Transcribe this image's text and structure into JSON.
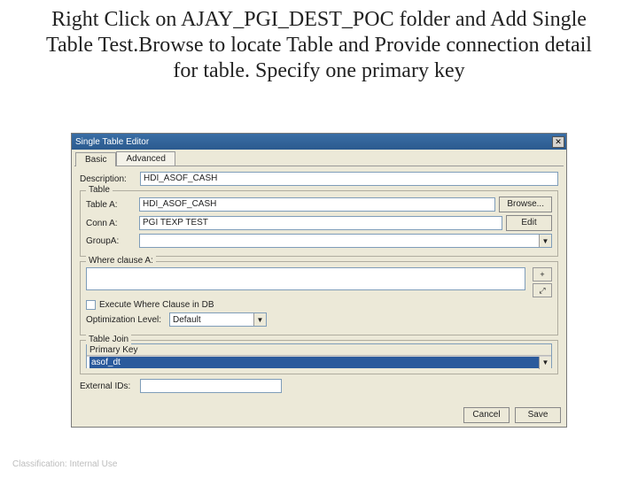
{
  "slide": {
    "title": "Right Click on AJAY_PGI_DEST_POC folder and Add Single Table Test.Browse to locate Table and Provide connection detail for table. Specify one primary key"
  },
  "window": {
    "title": "Single Table Editor"
  },
  "tabs": {
    "basic": "Basic",
    "advanced": "Advanced"
  },
  "fields": {
    "description_label": "Description:",
    "description_value": "HDI_ASOF_CASH",
    "table_legend": "Table",
    "tableA_label": "Table A:",
    "tableA_value": "HDI_ASOF_CASH",
    "browse": "Browse...",
    "connA_label": "Conn A:",
    "connA_value": "PGI TEXP TEST",
    "edit": "Edit",
    "groupA_label": "GroupA:",
    "groupA_value": "",
    "where_legend": "Where clause A:",
    "execute_label": "Execute Where Clause in DB",
    "opt_label": "Optimization Level:",
    "opt_value": "Default",
    "join_legend": "Table Join",
    "primary_key_header": "Primary Key",
    "primary_key_value": "asof_dt",
    "external_label": "External IDs:",
    "external_value": ""
  },
  "buttons": {
    "cancel": "Cancel",
    "save": "Save"
  },
  "footer": {
    "classification": "Classification: Internal Use"
  }
}
